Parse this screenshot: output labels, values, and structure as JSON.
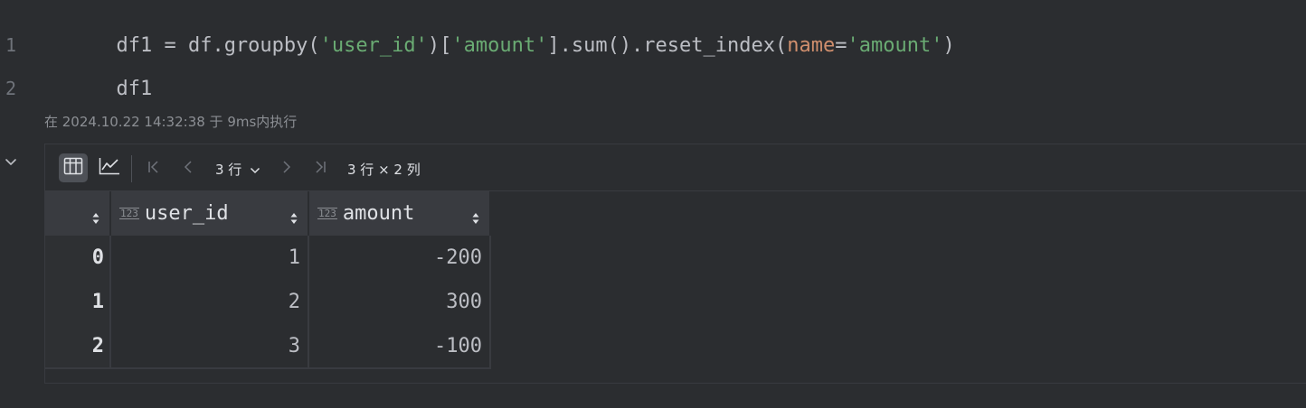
{
  "editor": {
    "lines": [
      {
        "number": "1",
        "tokens": [
          {
            "text": "df1 = df.groupby(",
            "kind": "plain"
          },
          {
            "text": "'user_id'",
            "kind": "str"
          },
          {
            "text": ")[",
            "kind": "plain"
          },
          {
            "text": "'amount'",
            "kind": "str"
          },
          {
            "text": "].sum().reset_index(",
            "kind": "plain"
          },
          {
            "text": "name",
            "kind": "kw"
          },
          {
            "text": "=",
            "kind": "plain"
          },
          {
            "text": "'amount'",
            "kind": "str"
          },
          {
            "text": ")",
            "kind": "plain"
          }
        ]
      },
      {
        "number": "2",
        "tokens": [
          {
            "text": "df1",
            "kind": "plain"
          }
        ]
      }
    ],
    "execution_info": "在 2024.10.22 14:32:38 于 9ms内执行"
  },
  "output": {
    "collapse_icon": "chevron-down-icon",
    "toolbar": {
      "table_view_icon": "table-icon",
      "chart_view_icon": "line-chart-icon",
      "first_page_icon": "first-page-icon",
      "prev_page_icon": "chevron-left-icon",
      "rows_selector": "3 行",
      "next_page_icon": "chevron-right-icon",
      "last_page_icon": "last-page-icon",
      "shape": "3 行 × 2 列"
    },
    "table": {
      "columns": [
        {
          "name": "",
          "type_badge": ""
        },
        {
          "name": "user_id",
          "type_badge": "123"
        },
        {
          "name": "amount",
          "type_badge": "123"
        }
      ],
      "rows": [
        [
          "0",
          "1",
          "-200"
        ],
        [
          "1",
          "2",
          "300"
        ],
        [
          "2",
          "3",
          "-100"
        ]
      ]
    }
  },
  "colors": {
    "background": "#2b2d30",
    "string": "#6aab73",
    "keyword_arg": "#cf8e6d",
    "text": "#bcbec4"
  }
}
